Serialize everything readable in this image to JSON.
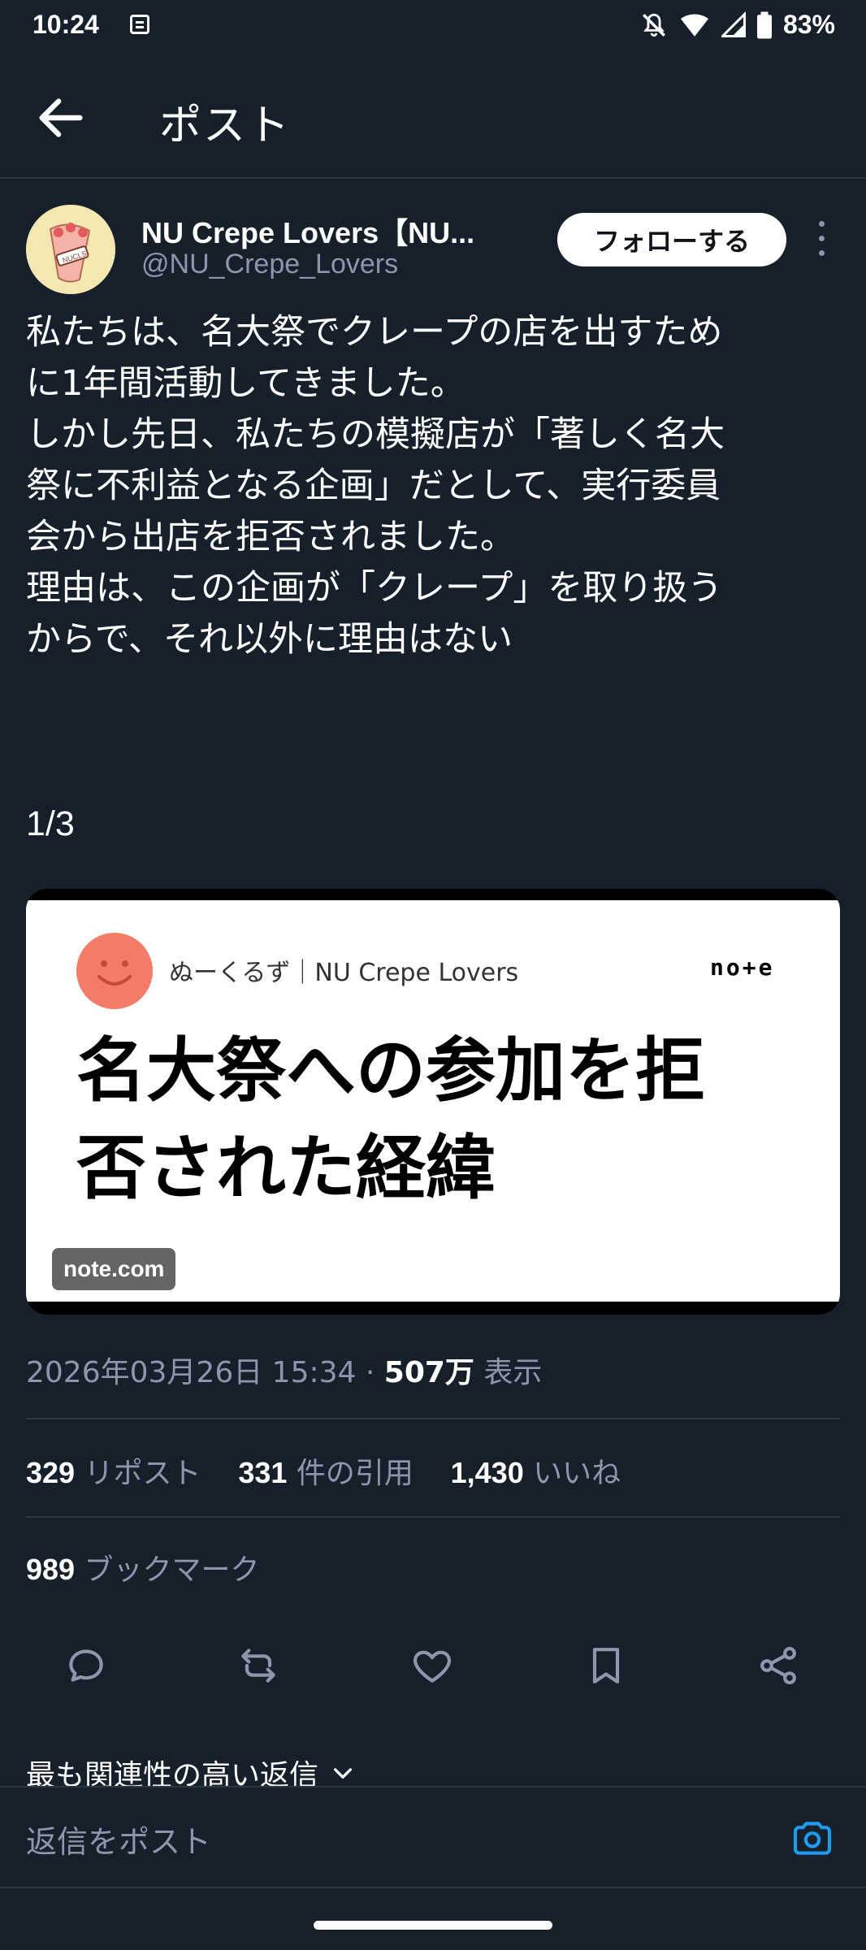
{
  "status": {
    "time": "10:24",
    "battery": "83%"
  },
  "header": {
    "title": "ポスト"
  },
  "author": {
    "name": "NU Crepe Lovers【NU...",
    "handle": "@NU_Crepe_Lovers",
    "follow_label": "フォローする"
  },
  "tweet": {
    "lines": [
      "私たちは、名大祭でクレープの店を出すため",
      "に1年間活動してきました。",
      "しかし先日、私たちの模擬店が「著しく名大",
      "祭に不利益となる企画」だとして、実行委員",
      "会から出店を拒否されました。",
      "理由は、この企画が「クレープ」を取り扱う",
      "からで、それ以外に理由はない"
    ],
    "count": "1/3"
  },
  "card": {
    "author": "ぬーくるず｜NU Crepe Lovers",
    "logo": "no+e",
    "title_line1": "名大祭への参加を拒",
    "title_line2": "否された経緯",
    "domain": "note.com"
  },
  "meta": {
    "datetime": "2026年03月26日 15:34 · ",
    "views": "507万",
    "views_label": " 表示"
  },
  "stats": {
    "reposts": "329",
    "reposts_label": " リポスト",
    "quotes": "331",
    "quotes_label": " 件の引用",
    "likes": "1,430",
    "likes_label": " いいね",
    "bookmarks": "989",
    "bookmarks_label": " ブックマーク"
  },
  "replies": {
    "sort_label": "最も関連性の高い返信",
    "input_placeholder": "返信をポスト"
  },
  "colors": {
    "background": "#15202b",
    "accent": "#1d9bf0",
    "muted": "#8b98a5"
  }
}
